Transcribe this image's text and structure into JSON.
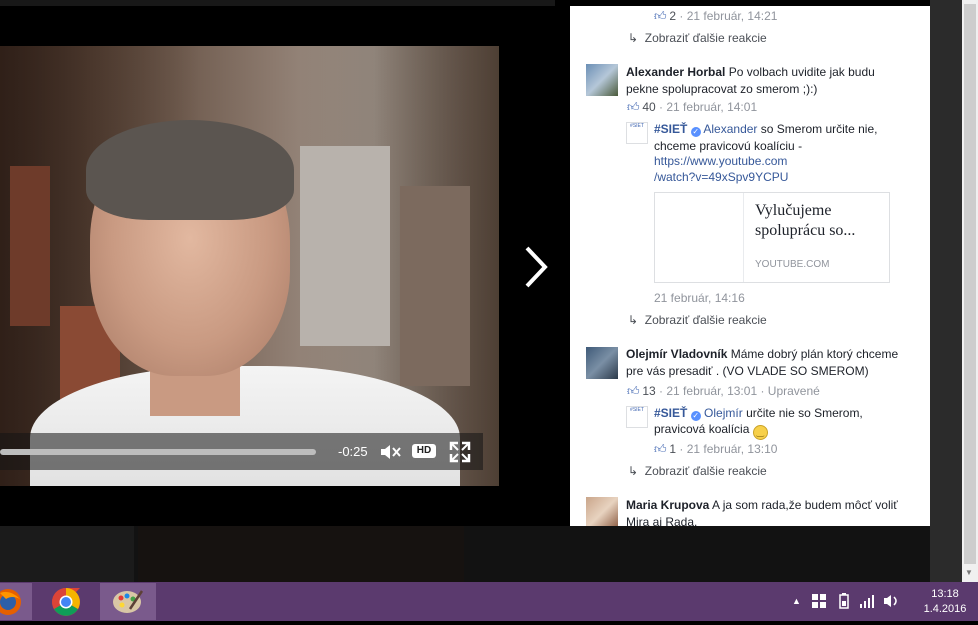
{
  "video": {
    "time_remaining": "-0:25",
    "hd_label": "HD"
  },
  "comments": {
    "top_reply_meta": {
      "likes": "2",
      "time": "21 február, 14:21"
    },
    "show_more_1": "Zobraziť ďalšie reakcie",
    "c1": {
      "author": "Alexander Horbal",
      "text": "Po volbach uvidite jak budu pekne spolupracovat zo smerom ;):)",
      "likes": "40",
      "time": "21 február, 14:01"
    },
    "r1": {
      "author": "#SIEŤ",
      "mention": "Alexander",
      "text": "so Smerom určite nie, chceme pravicovú koalíciu -",
      "url_line1": "https://www.youtube.com",
      "url_line2": "/watch?v=49xSpv9YCPU",
      "preview_title": "Vylučujeme spoluprácu so...",
      "preview_domain": "YOUTUBE.COM",
      "time": "21 február, 14:16"
    },
    "show_more_2": "Zobraziť ďalšie reakcie",
    "c2": {
      "author": "Olejmír Vladovník",
      "text": "Máme dobrý plán ktorý chceme pre vás presadiť . (VO VLADE SO SMEROM)",
      "likes": "13",
      "time": "21 február, 13:01",
      "edited": "Upravené"
    },
    "r2": {
      "author": "#SIEŤ",
      "mention": "Olejmír",
      "text_line1": "určite nie so Smerom,",
      "text_line2": "pravicová koalícia",
      "likes": "1",
      "time": "21 február, 13:10"
    },
    "show_more_3": "Zobraziť ďalšie reakcie",
    "c3": {
      "author": "Maria Krupova",
      "text": "A ja som rada,že budem môcť voliť Mira aj Rada."
    },
    "page_avatar_text": "#SIEŤ"
  },
  "taskbar": {
    "time": "13:18",
    "date": "1.4.2016"
  },
  "colors": {
    "link": "#365899",
    "taskbar": "#5b3a6e",
    "meta": "#90949c"
  }
}
